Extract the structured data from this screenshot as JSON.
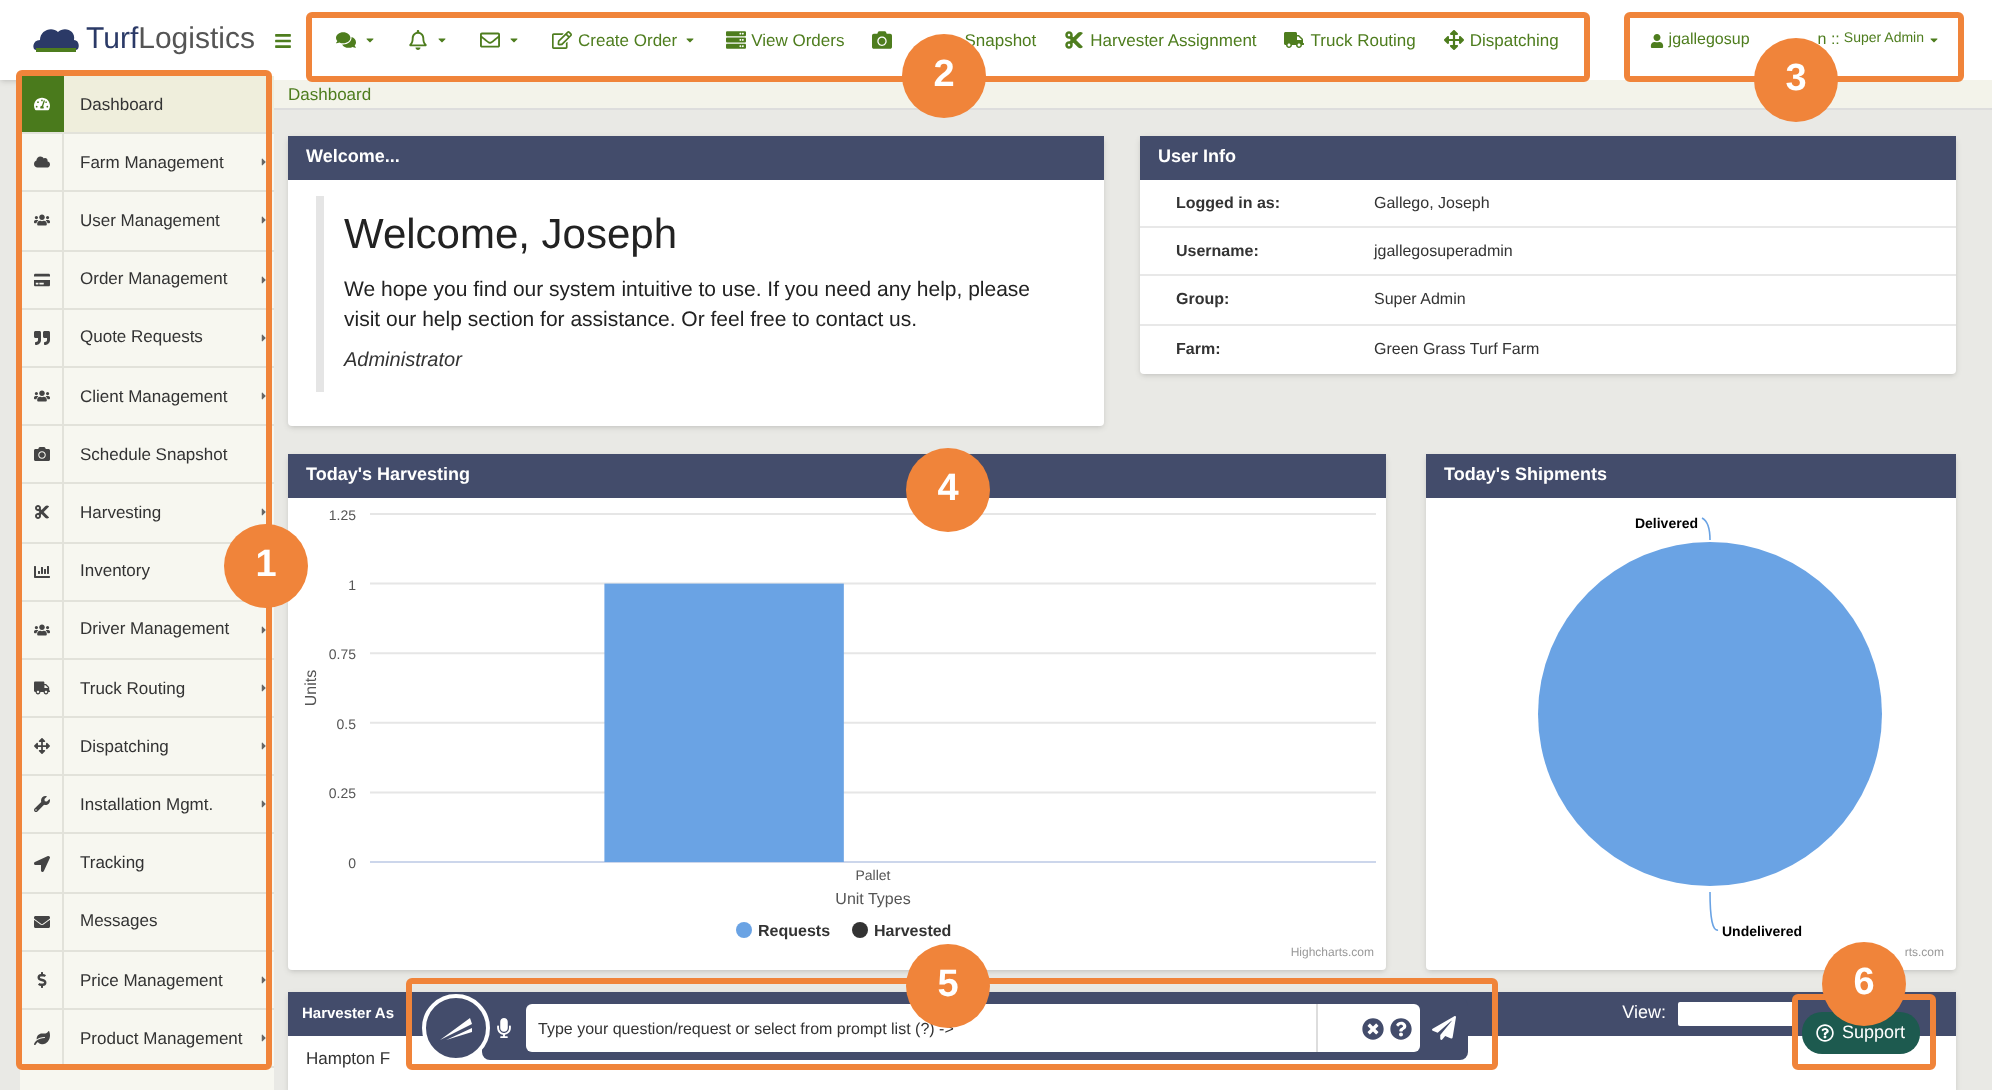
{
  "logo": {
    "first": "Turf",
    "second": "Logistics"
  },
  "top_nav": [
    {
      "kind": "icon-menu"
    },
    {
      "kind": "icon-menu"
    },
    {
      "kind": "icon-menu"
    },
    {
      "kind": "menu",
      "label": "Create Order"
    },
    {
      "kind": "link",
      "label": "View Orders"
    },
    {
      "kind": "link",
      "label": "Snapshot"
    },
    {
      "kind": "link",
      "label": "Harvester Assignment"
    },
    {
      "kind": "link",
      "label": "Truck Routing"
    },
    {
      "kind": "link",
      "label": "Dispatching"
    }
  ],
  "user_menu": {
    "name": "jgallegosup",
    "rest": "n ::",
    "role": "Super Admin"
  },
  "breadcrumb": "Dashboard",
  "sidebar": {
    "items": [
      {
        "label": "Dashboard",
        "selected": true,
        "submenu": false
      },
      {
        "label": "Farm Management",
        "selected": false,
        "submenu": true
      },
      {
        "label": "User Management",
        "selected": false,
        "submenu": true
      },
      {
        "label": "Order Management",
        "selected": false,
        "submenu": true
      },
      {
        "label": "Quote Requests",
        "selected": false,
        "submenu": true
      },
      {
        "label": "Client Management",
        "selected": false,
        "submenu": true
      },
      {
        "label": "Schedule Snapshot",
        "selected": false,
        "submenu": false
      },
      {
        "label": "Harvesting",
        "selected": false,
        "submenu": true
      },
      {
        "label": "Inventory",
        "selected": false,
        "submenu": false
      },
      {
        "label": "Driver Management",
        "selected": false,
        "submenu": true
      },
      {
        "label": "Truck Routing",
        "selected": false,
        "submenu": true
      },
      {
        "label": "Dispatching",
        "selected": false,
        "submenu": true
      },
      {
        "label": "Installation Mgmt.",
        "selected": false,
        "submenu": true
      },
      {
        "label": "Tracking",
        "selected": false,
        "submenu": false
      },
      {
        "label": "Messages",
        "selected": false,
        "submenu": false
      },
      {
        "label": "Price Management",
        "selected": false,
        "submenu": true
      },
      {
        "label": "Product Management",
        "selected": false,
        "submenu": true
      }
    ]
  },
  "welcome": {
    "title": "Welcome...",
    "heading": "Welcome, Joseph",
    "text": "We hope you find our system intuitive to use. If you need any help, please visit our help section for assistance. Or feel free to contact us.",
    "signature": "Administrator"
  },
  "user_info": {
    "title": "User Info",
    "rows": [
      {
        "label": "Logged in as:",
        "value": "Gallego, Joseph"
      },
      {
        "label": "Username:",
        "value": "jgallegosuperadmin"
      },
      {
        "label": "Group:",
        "value": "Super Admin"
      },
      {
        "label": "Farm:",
        "value": "Green Grass Turf Farm"
      }
    ]
  },
  "harvesting": {
    "title": "Today's Harvesting",
    "credit": "Highcharts.com",
    "chart_data": {
      "type": "bar",
      "xlabel": "Unit Types",
      "ylabel": "Units",
      "categories": [
        "Pallet"
      ],
      "series": [
        {
          "name": "Requests",
          "color": "#6aa3e4",
          "values": [
            1
          ]
        },
        {
          "name": "Harvested",
          "color": "#333333",
          "values": [
            0
          ]
        }
      ],
      "ylim": [
        0,
        1.25
      ],
      "grid": true,
      "yticks": [
        0,
        0.25,
        0.5,
        0.75,
        1,
        1.25
      ]
    }
  },
  "shipments": {
    "title": "Today's Shipments",
    "credit": "rts.com",
    "chart_data": {
      "type": "pie",
      "categories": [
        "Delivered",
        "Undelivered"
      ],
      "values": [
        0,
        1
      ]
    }
  },
  "harvester_panel": {
    "title": "Harvester As",
    "view_label": "View:",
    "row": "Hampton F"
  },
  "assistant": {
    "placeholder": "Type your question/request or select from prompt list (?) ->"
  },
  "support": {
    "label": "Support"
  },
  "annotations": [
    {
      "number": "1"
    },
    {
      "number": "2"
    },
    {
      "number": "3"
    },
    {
      "number": "4"
    },
    {
      "number": "5"
    },
    {
      "number": "6"
    }
  ]
}
